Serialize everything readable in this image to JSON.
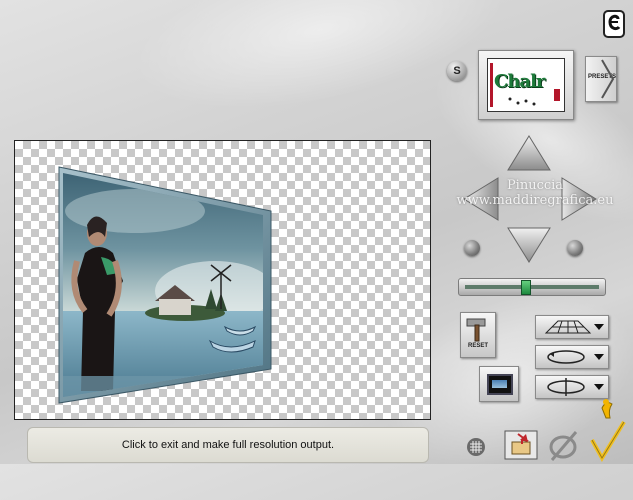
{
  "status_bar": {
    "message": "Click to exit and make full resolution output."
  },
  "presets": {
    "button_label": "PRESETS",
    "thumbnail_text": "Chalr"
  },
  "controls": {
    "reset_label": "RESET",
    "s_label": "S"
  },
  "slider": {
    "value": 0.45
  },
  "watermark": {
    "line1": "Pinuccia",
    "line2": "www.maddiregrafica.eu"
  },
  "icons": {
    "logo": "e-icon",
    "arrows": [
      "arrow-up-icon",
      "arrow-left-icon",
      "arrow-right-icon",
      "arrow-down-icon"
    ],
    "grid": "grid-icon",
    "cancel": "cancel-icon",
    "ok": "checkmark-icon",
    "help": "hand-pointer-icon"
  }
}
